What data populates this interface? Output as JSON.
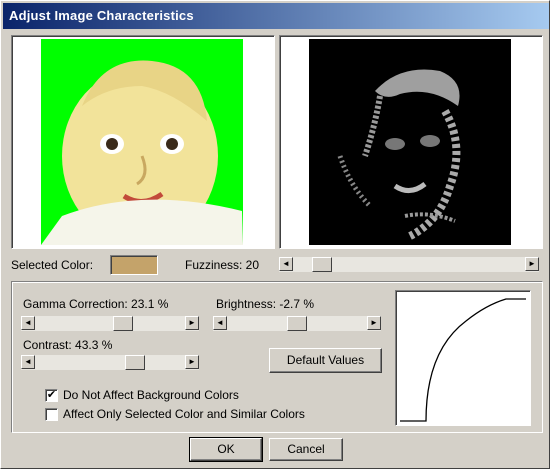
{
  "window": {
    "title": "Adjust Image Characteristics"
  },
  "colors": {
    "selected_swatch": "#c4a36a",
    "title_start": "#0a246a",
    "title_end": "#a6caf0",
    "green_bg": "#00ff00"
  },
  "preview": {
    "left_image": "baby-portrait-photo",
    "right_image": "edge-mask-preview"
  },
  "selected_color": {
    "label": "Selected Color:"
  },
  "fuzziness": {
    "label": "Fuzziness: 20",
    "value": 20,
    "position": 0.16
  },
  "gamma": {
    "label": "Gamma Correction: 23.1 %",
    "value": 23.1,
    "position": 0.58
  },
  "brightness": {
    "label": "Brightness: -2.7 %",
    "value": -2.7,
    "position": 0.48
  },
  "contrast": {
    "label": "Contrast: 43.3 %",
    "value": 43.3,
    "position": 0.67
  },
  "buttons": {
    "default_values": "Default Values",
    "ok": "OK",
    "cancel": "Cancel"
  },
  "options": [
    {
      "label": "Do Not Affect Background Colors",
      "checked": true
    },
    {
      "label": "Affect Only Selected Color and Similar Colors",
      "checked": false
    }
  ],
  "glyphs": {
    "left_arrow": "◄",
    "right_arrow": "►",
    "check": "✔"
  }
}
